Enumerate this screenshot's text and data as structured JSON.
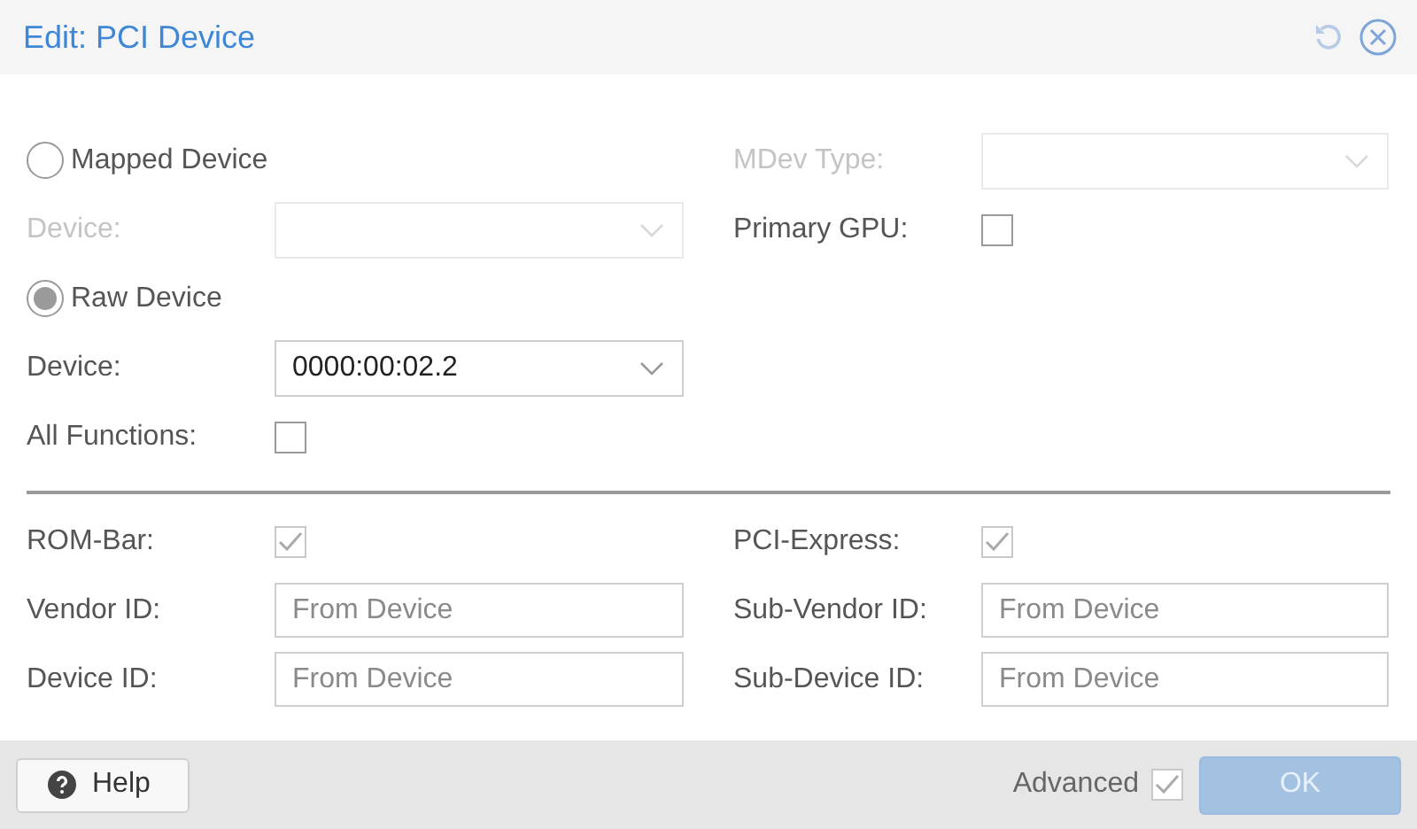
{
  "window": {
    "title": "Edit: PCI Device"
  },
  "left": [
    {
      "kind": "radio",
      "label": "Mapped Device",
      "selected": false
    },
    {
      "kind": "combo",
      "label": "Device:",
      "disabled": true
    },
    {
      "kind": "radio",
      "label": "Raw Device",
      "selected": true
    },
    {
      "kind": "combo",
      "label": "Device:",
      "disabled": false,
      "value": "0000:00:02.2"
    },
    {
      "kind": "check",
      "label": "All Functions:",
      "checked": false,
      "disabled": false
    }
  ],
  "right": [
    {
      "kind": "combo",
      "label": "MDev Type:",
      "disabled": true
    },
    {
      "kind": "check",
      "label": "Primary GPU:",
      "checked": false,
      "disabled": false
    }
  ],
  "advanced_left": [
    {
      "kind": "check",
      "label": "ROM-Bar:",
      "checked": true,
      "disabled": true
    },
    {
      "kind": "text",
      "label": "Vendor ID:",
      "placeholder": "From Device"
    },
    {
      "kind": "text",
      "label": "Device ID:",
      "placeholder": "From Device"
    }
  ],
  "advanced_right": [
    {
      "kind": "check",
      "label": "PCI-Express:",
      "checked": true,
      "disabled": true
    },
    {
      "kind": "text",
      "label": "Sub-Vendor ID:",
      "placeholder": "From Device"
    },
    {
      "kind": "text",
      "label": "Sub-Device ID:",
      "placeholder": "From Device"
    }
  ],
  "footer": {
    "help": "Help",
    "advanced": {
      "label": "Advanced",
      "checked": true
    },
    "ok": {
      "label": "OK",
      "disabled": true
    }
  }
}
